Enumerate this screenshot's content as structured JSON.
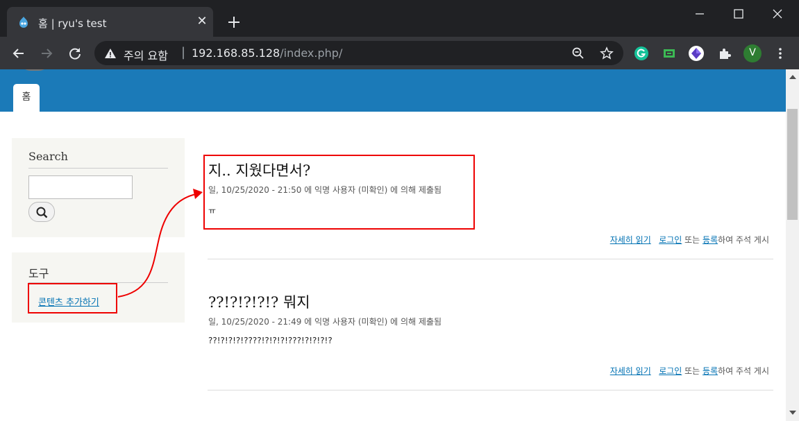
{
  "browser": {
    "tab_title": "홈 | ryu's test",
    "security_warning": "주의 요함",
    "url_host": "192.168.85.128",
    "url_path": "/index.php/",
    "profile_initial": "V",
    "colors": {
      "chrome_dark": "#202124",
      "chrome_mid": "#35363a",
      "profile": "#2e7d32"
    }
  },
  "site": {
    "header_color": "#1b7ab8",
    "nav": {
      "home_tab": "홈"
    }
  },
  "sidebar": {
    "search": {
      "title": "Search",
      "input_value": ""
    },
    "tools": {
      "title": "도구",
      "add_content": "콘텐츠 추가하기"
    }
  },
  "articles": [
    {
      "title": "지.. 지웠다면서?",
      "meta": "일, 10/25/2020 - 21:50 에 익명 사용자 (미확인) 에 의해 제출됨",
      "body": "ㅠ",
      "read_more": "자세히 읽기",
      "login": "로그인",
      "or": " 또는 ",
      "register": "등록",
      "suffix": "하여 주석 게시"
    },
    {
      "title": "??!?!?!?!? 뭐지",
      "meta": "일, 10/25/2020 - 21:49 에 익명 사용자 (미확인) 에 의해 제출됨",
      "body": "??!?!?!?!????!?!?!?!???!?!?!?!?",
      "read_more": "자세히 읽기",
      "login": "로그인",
      "or": " 또는 ",
      "register": "등록",
      "suffix": "하여 주석 게시"
    }
  ],
  "annotation": {
    "color": "#e00000"
  }
}
